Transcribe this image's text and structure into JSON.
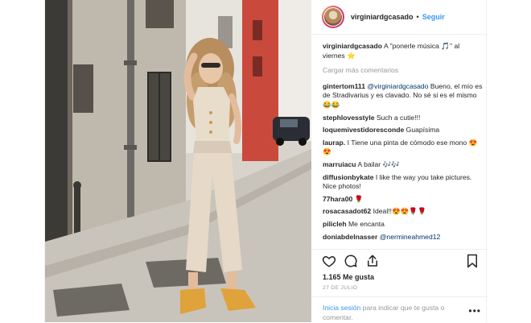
{
  "header": {
    "username": "virginiardgcasado",
    "separator": "•",
    "follow_label": "Seguir"
  },
  "caption": {
    "username": "virginiardgcasado",
    "text": "A \"ponerle música 🎵\" al viernes ⭐"
  },
  "load_more_label": "Cargar más comentarios",
  "comments": [
    {
      "user": "gintertom111",
      "mention": "@virginiardgcasado",
      "text": " Bueno, el mío es de Stradivarius y es clavado. No sé si es el mismo😂😂"
    },
    {
      "user": "stephlovesstyle",
      "mention": "",
      "text": "Such a cutie!!!"
    },
    {
      "user": "loquemivestidoresconde",
      "mention": "",
      "text": "Guapísima"
    },
    {
      "user": "laurap.",
      "mention": "",
      "text": "I Tiene una pinta de cómodo ese mono 😍😍"
    },
    {
      "user": "marruiacu",
      "mention": "",
      "text": "A bailar 🎶🎶"
    },
    {
      "user": "diffusionbykate",
      "mention": "",
      "text": "I like the way you take pictures. Nice photos!"
    },
    {
      "user": "77hara00",
      "mention": "",
      "text": "🌹"
    },
    {
      "user": "rosacasadot62",
      "mention": "",
      "text": "Ideal!!😍😍🌹🌹"
    },
    {
      "user": "pilicleh",
      "mention": "",
      "text": "Me encanta"
    },
    {
      "user": "doniabdelnasser",
      "mention": "@nermineahmed12",
      "text": ""
    }
  ],
  "likes_text": "1.165 Me gusta",
  "date_text": "27 DE JULIO",
  "login": {
    "link_label": "Inicia sesión",
    "text": " para indicar que te gusta o comentar."
  },
  "more_label": "•••",
  "icons": [
    "heart-icon",
    "comment-icon",
    "share-icon",
    "bookmark-icon",
    "chevron-right-icon"
  ],
  "colors": {
    "accent": "#3897f0",
    "text": "#262626",
    "muted": "#999999",
    "border": "#efefef"
  }
}
